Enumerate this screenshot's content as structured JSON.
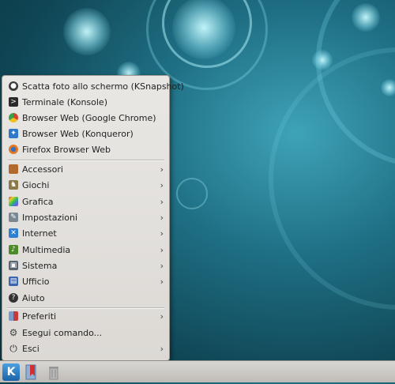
{
  "menu": {
    "items": [
      {
        "label": "Scatta foto allo schermo (KSnapshot)",
        "icon": "camera-icon",
        "color": "#3b3b3b",
        "submenu": false
      },
      {
        "label": "Terminale (Konsole)",
        "icon": "terminal-icon",
        "color": "#2a2a2a",
        "submenu": false
      },
      {
        "label": "Browser Web (Google Chrome)",
        "icon": "chrome-icon",
        "color": "#d9402b",
        "submenu": false
      },
      {
        "label": "Browser Web (Konqueror)",
        "icon": "konqueror-icon",
        "color": "#2f78c9",
        "submenu": false
      },
      {
        "label": "Firefox Browser Web",
        "icon": "firefox-icon",
        "color": "#e3781e",
        "submenu": false
      },
      {
        "label": "Accessori",
        "icon": "accessories-icon",
        "color": "#b46a2c",
        "submenu": true
      },
      {
        "label": "Giochi",
        "icon": "games-icon",
        "color": "#8a7a4a",
        "submenu": true
      },
      {
        "label": "Grafica",
        "icon": "graphics-icon",
        "color": "#c23ad0",
        "submenu": true
      },
      {
        "label": "Impostazioni",
        "icon": "settings-icon",
        "color": "#7a8894",
        "submenu": true
      },
      {
        "label": "Internet",
        "icon": "internet-icon",
        "color": "#2f7fd0",
        "submenu": true
      },
      {
        "label": "Multimedia",
        "icon": "multimedia-icon",
        "color": "#4d8a2a",
        "submenu": true
      },
      {
        "label": "Sistema",
        "icon": "system-icon",
        "color": "#5a6470",
        "submenu": true
      },
      {
        "label": "Ufficio",
        "icon": "office-icon",
        "color": "#3a66b0",
        "submenu": true
      },
      {
        "label": "Aiuto",
        "icon": "help-icon",
        "color": "#333333",
        "submenu": false
      },
      {
        "label": "Preferiti",
        "icon": "bookmark-icon",
        "color": "#c83a3a",
        "submenu": true
      },
      {
        "label": "Esegui comando...",
        "icon": "gear-icon",
        "color": "#444444",
        "submenu": false
      },
      {
        "label": "Esci",
        "icon": "power-icon",
        "color": "#333333",
        "submenu": true
      }
    ]
  },
  "taskbar": {
    "kmenu_label": "K"
  }
}
